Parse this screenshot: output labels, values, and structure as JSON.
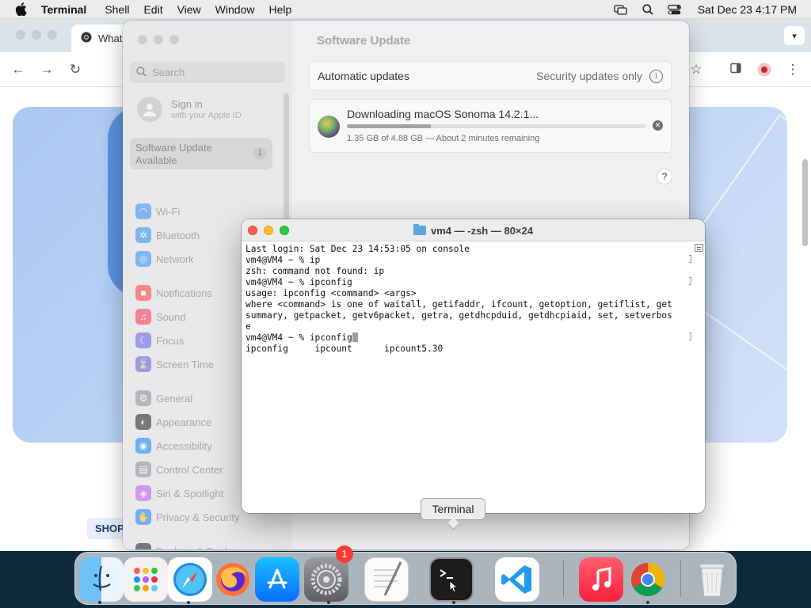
{
  "menubar": {
    "app_name": "Terminal",
    "items": [
      "Shell",
      "Edit",
      "View",
      "Window",
      "Help"
    ],
    "clock": "Sat Dec 23  4:17 PM",
    "icons": [
      "screen-mirroring-icon",
      "search-icon",
      "control-center-icon"
    ]
  },
  "chrome": {
    "tab_title": "What",
    "promo_label": "SHOP"
  },
  "settings": {
    "search_placeholder": "Search",
    "account": {
      "title": "Sign in",
      "subtitle": "with your Apple ID"
    },
    "update_item": {
      "label": "Software Update Available",
      "count": "1"
    },
    "sidebar_items": [
      {
        "label": "Wi-Fi",
        "icon": "wifi-icon",
        "color": "#2f8cf5"
      },
      {
        "label": "Bluetooth",
        "icon": "bluetooth-icon",
        "color": "#2f8cf5"
      },
      {
        "label": "Network",
        "icon": "network-icon",
        "color": "#2f8cf5"
      },
      {
        "label": "Notifications",
        "icon": "bell-icon",
        "color": "#ff3b30"
      },
      {
        "label": "Sound",
        "icon": "speaker-icon",
        "color": "#ff2d55"
      },
      {
        "label": "Focus",
        "icon": "moon-icon",
        "color": "#5e5ce6"
      },
      {
        "label": "Screen Time",
        "icon": "hourglass-icon",
        "color": "#5e5ce6"
      },
      {
        "label": "General",
        "icon": "gear-icon",
        "color": "#8e8e93"
      },
      {
        "label": "Appearance",
        "icon": "appearance-icon",
        "color": "#1c1c1e"
      },
      {
        "label": "Accessibility",
        "icon": "accessibility-icon",
        "color": "#0a84ff"
      },
      {
        "label": "Control Center",
        "icon": "control-center-icon",
        "color": "#8e8e93"
      },
      {
        "label": "Siri & Spotlight",
        "icon": "siri-icon",
        "color": "#bf5af2"
      },
      {
        "label": "Privacy & Security",
        "icon": "hand-icon",
        "color": "#0a84ff"
      },
      {
        "label": "Desktop & Dock",
        "icon": "dock-icon",
        "color": "#1c1c1e"
      }
    ],
    "content_title": "Software Update",
    "automatic_updates": {
      "label": "Automatic updates",
      "value": "Security updates only"
    },
    "download": {
      "title": "Downloading macOS Sonoma 14.2.1...",
      "status": "1.35 GB of 4.88 GB — About 2 minutes remaining",
      "progress": 0.28
    },
    "help_label": "?"
  },
  "terminal": {
    "title": "vm4 — -zsh — 80×24",
    "lines": [
      "Last login: Sat Dec 23 14:53:05 on console",
      "vm4@VM4 ~ % ip",
      "zsh: command not found: ip",
      "vm4@VM4 ~ % ipconfig",
      "usage: ipconfig <command> <args>",
      "where <command> is one of waitall, getifaddr, ifcount, getoption, getiflist, get",
      "summary, getpacket, getv6packet, getra, getdhcpduid, getdhcpiaid, set, setverbos",
      "e",
      "vm4@VM4 ~ % ipconfig",
      "ipconfig     ipcount      ipcount5.30"
    ]
  },
  "dock": {
    "tooltip": "Terminal",
    "settings_badge": "1",
    "apps": [
      {
        "name": "Finder",
        "icon": "finder-icon"
      },
      {
        "name": "Launchpad",
        "icon": "launchpad-icon"
      },
      {
        "name": "Safari",
        "icon": "safari-icon"
      },
      {
        "name": "Firefox",
        "icon": "firefox-icon"
      },
      {
        "name": "App Store",
        "icon": "app-store-icon"
      },
      {
        "name": "System Settings",
        "icon": "system-settings-icon"
      },
      {
        "name": "TextEdit",
        "icon": "textedit-icon"
      },
      {
        "name": "Terminal",
        "icon": "terminal-icon"
      },
      {
        "name": "Visual Studio Code",
        "icon": "vscode-icon"
      },
      {
        "name": "Music",
        "icon": "music-icon"
      },
      {
        "name": "Google Chrome",
        "icon": "chrome-icon"
      },
      {
        "name": "Trash",
        "icon": "trash-icon"
      }
    ]
  }
}
